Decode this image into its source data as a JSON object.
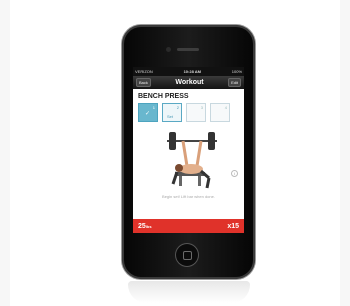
{
  "status_bar": {
    "carrier": "VERIZON",
    "time": "10:28 AM",
    "battery": "100%"
  },
  "nav": {
    "back_label": "Back",
    "title": "Workout",
    "edit_label": "Edit"
  },
  "exercise": {
    "name": "BENCH PRESS"
  },
  "sets": [
    {
      "number": "1",
      "state": "done",
      "label": "✓"
    },
    {
      "number": "2",
      "state": "current",
      "label": "Set"
    },
    {
      "number": "3",
      "state": "pending",
      "label": ""
    },
    {
      "number": "4",
      "state": "pending",
      "label": ""
    }
  ],
  "hint": "Begin set! Lift bar when done.",
  "bottom": {
    "weight_value": "25",
    "weight_unit": "lbs",
    "reps": "x15"
  },
  "colors": {
    "accent_blue": "#69b7ce",
    "bottom_red": "#e0322a"
  }
}
